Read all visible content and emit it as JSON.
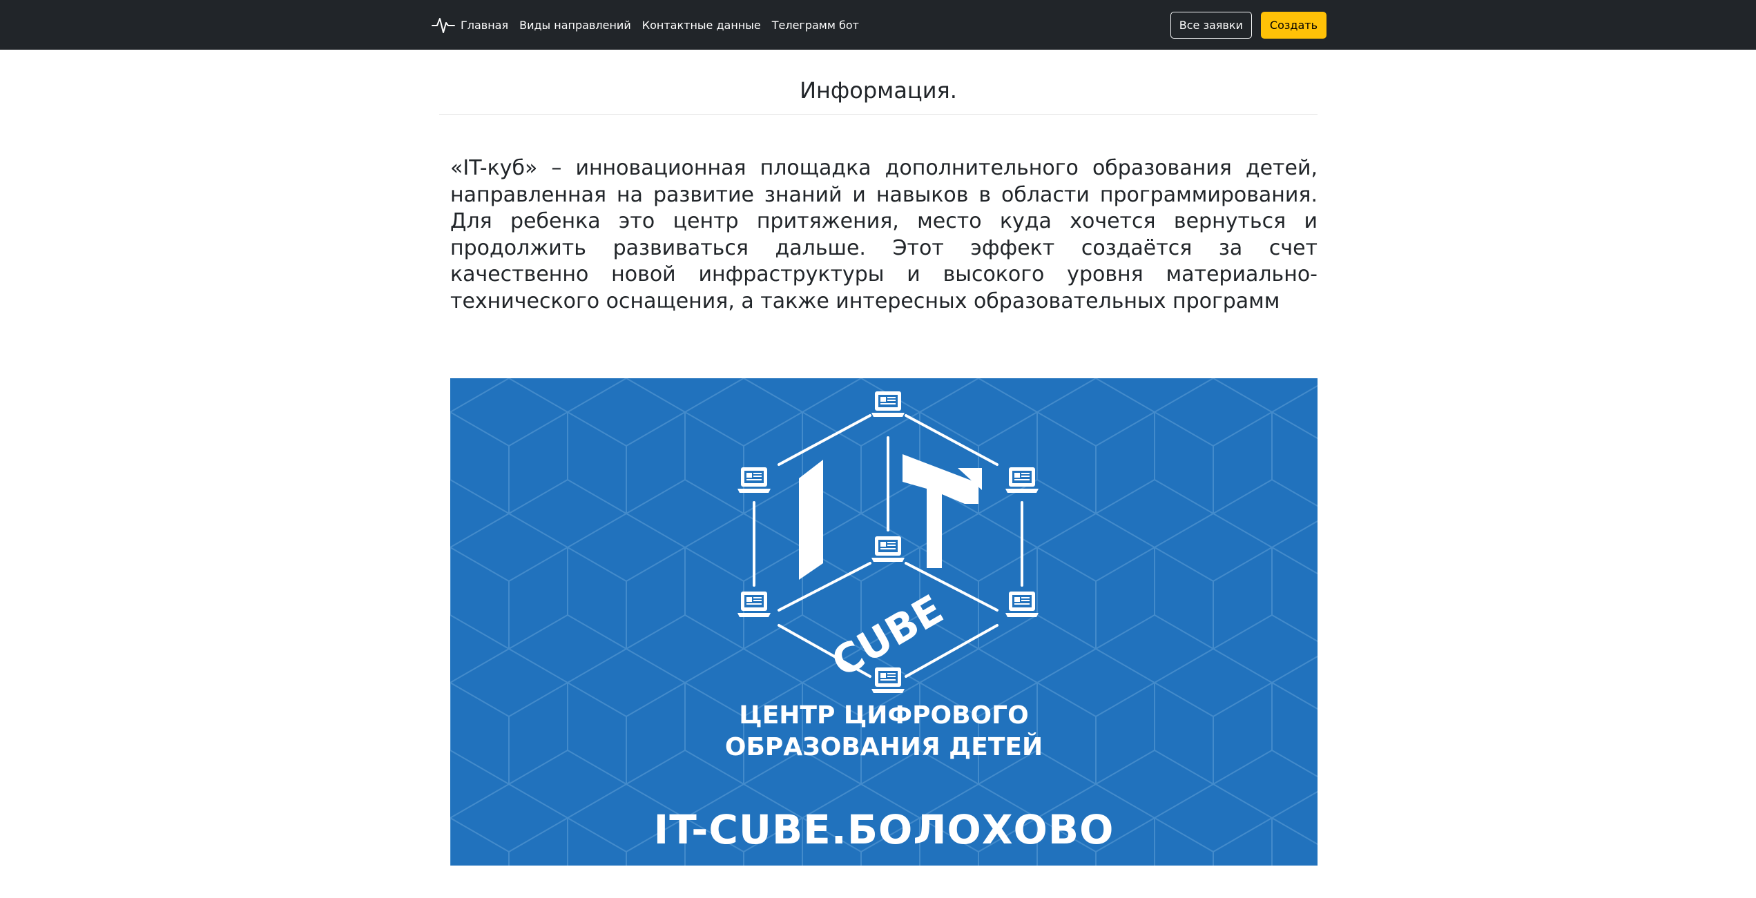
{
  "navbar": {
    "brand_icon": "pulse-icon",
    "links": [
      "Главная",
      "Виды направлений",
      "Контактные данные",
      "Телеграмм бот"
    ],
    "all_requests_label": "Все заявки",
    "create_label": "Создать",
    "colors": {
      "background": "#212529",
      "accent": "#ffc107"
    }
  },
  "main": {
    "heading": "Информация.",
    "description": "«IT-куб» – инновационная площадка дополнительного образования детей, направленная на развитие знаний и навыков в области программирования. Для ребенка это центр притяжения, место куда хочется вернуться и продолжить развиваться дальше. Этот эффект создаётся за счет качественно новой инфраструктуры и высокого уровня материально-технического оснащения, а также интересных образовательных программ"
  },
  "banner": {
    "background_color": "#2172bd",
    "logo_letters": "IT",
    "logo_word": "CUBE",
    "subtitle_line1": "ЦЕНТР ЦИФРОВОГО",
    "subtitle_line2": "ОБРАЗОВАНИЯ ДЕТЕЙ",
    "site": "IT-CUBE.БОЛОХОВО"
  }
}
